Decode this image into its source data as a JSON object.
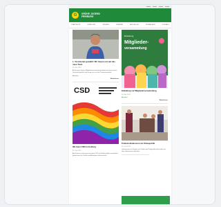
{
  "site": {
    "name_line1": "GRÜNE JUGEND",
    "name_line2": "FREIBURG",
    "logo_letter": "G",
    "brand_color": "#1f8a3a"
  },
  "nav": [
    "STARTSEITE",
    "ÜBER UNS",
    "THEMEN",
    "TERMINE",
    "AKTUELLES",
    "MITMACHEN",
    "KONTAKT"
  ],
  "posts": {
    "left": [
      {
        "title": "1. Vorsitzende gewählt: Wir freuen uns auf das neue Team",
        "date": "11. Mai 2023",
        "excerpt": "Auf unserer letzten Mitgliederversammlung haben wir einen neuen Vorstand gewählt und freuen uns auf die Zusammenarbeit.",
        "tags": "Aktuelles",
        "more": "Weiterlesen"
      },
      {
        "image_text": "CSD",
        "title": "Wir beim CSD in Freiburg",
        "date": "25. Juli 2022",
        "excerpt": "Auch dieses Jahr waren wir beim CSD in Freiburg dabei und haben gemeinsam für Vielfalt und Akzeptanz demonstriert.",
        "tags": "Aktuelles",
        "more": "Weiterlesen"
      }
    ],
    "right": [
      {
        "image_text": "Einladung Mitgliederversammlung",
        "title": "Einladung zur Mitgliederversammlung",
        "date": "05. Mai 2023",
        "tags": "Aktuelles",
        "more": "Weiterlesen"
      },
      {
        "title": "Podiumsdiskussion zur Klimapolitik",
        "date": "20. Juni 2022",
        "excerpt": "Gemeinsam mit Gästen aus Politik und Zivilgesellschaft haben wir über Klimaschutz diskutiert.",
        "tags": "Aktuelles",
        "more": "Weiterlesen"
      }
    ]
  }
}
